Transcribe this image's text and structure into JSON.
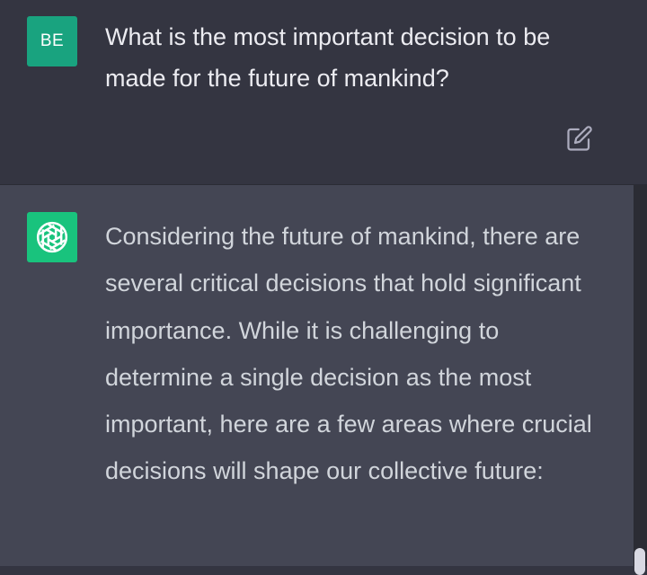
{
  "user_message": {
    "avatar_initials": "BE",
    "avatar_color": "#19a37f",
    "text": "What is the most important decision to be made for the future of mankind?",
    "edit_icon": "edit-icon"
  },
  "assistant_message": {
    "avatar_icon": "openai-logo-icon",
    "avatar_color": "#19c37d",
    "text": "Considering the future of mankind, there are several critical decisions that hold significant importance. While it is challenging to determine a single decision as the most important, here are a few areas where crucial decisions will shape our collective future:"
  },
  "colors": {
    "user_bg": "#343541",
    "assistant_bg": "#444654",
    "user_text": "#ececf1",
    "assistant_text": "#d1d5db"
  }
}
